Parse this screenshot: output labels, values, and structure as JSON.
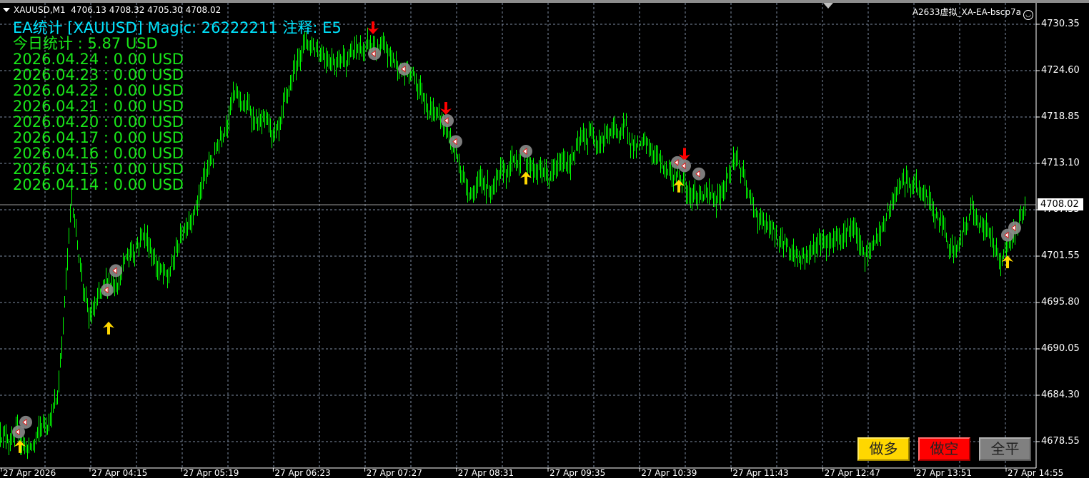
{
  "header": {
    "symbol": "XAUUSD,M1",
    "ohlc": "4706.13 4708.32 4705.30 4708.02",
    "account": "A2633虚拟_XA-EA-bscp7a",
    "account_icon": "smiley-icon"
  },
  "stats": {
    "title": "EA统计 [XAUUSD] Magic: 26222211 注释: E5",
    "lines": [
      "今日统计 : 5.87 USD",
      "2026.04.24 : 0.00 USD",
      "2026.04.23 : 0.00 USD",
      "2026.04.22 : 0.00 USD",
      "2026.04.21 : 0.00 USD",
      "2026.04.20 : 0.00 USD",
      "2026.04.17 : 0.00 USD",
      "2026.04.16 : 0.00 USD",
      "2026.04.15 : 0.00 USD",
      "2026.04.14 : 0.00 USD"
    ]
  },
  "buttons": {
    "buy": "做多",
    "sell": "做空",
    "close_all": "全平"
  },
  "colors": {
    "bars": "#00ff00",
    "buy": "#ffd700",
    "sell": "#ff0000",
    "close": "#808080",
    "title": "#00e5ff",
    "stats": "#19e619",
    "grid": "#7f8ea3"
  },
  "chart_data": {
    "type": "bar",
    "timeframe": "M1",
    "current_price": "4708.02",
    "price_ticks": [
      "4730.35",
      "4724.60",
      "4718.85",
      "4713.10",
      "4707.35",
      "4701.55",
      "4695.80",
      "4690.05",
      "4684.30",
      "4678.55"
    ],
    "time_ticks": [
      "27 Apr 2026",
      "27 Apr 04:15",
      "27 Apr 05:19",
      "27 Apr 06:23",
      "27 Apr 07:27",
      "27 Apr 08:31",
      "27 Apr 09:35",
      "27 Apr 10:39",
      "27 Apr 11:43",
      "27 Apr 12:47",
      "27 Apr 13:51",
      "27 Apr 14:55"
    ],
    "grid": true,
    "price_path": [
      {
        "t": "03:12",
        "p": 4680.2
      },
      {
        "t": "03:34",
        "p": 4677.6
      },
      {
        "t": "03:52",
        "p": 4683.8
      },
      {
        "t": "04:02",
        "p": 4708.6
      },
      {
        "t": "04:14",
        "p": 4693.5
      },
      {
        "t": "04:32",
        "p": 4698.8
      },
      {
        "t": "04:52",
        "p": 4705.0
      },
      {
        "t": "05:09",
        "p": 4698.0
      },
      {
        "t": "05:22",
        "p": 4706.0
      },
      {
        "t": "05:42",
        "p": 4714.0
      },
      {
        "t": "05:54",
        "p": 4721.8
      },
      {
        "t": "06:27",
        "p": 4715.6
      },
      {
        "t": "06:44",
        "p": 4728.5
      },
      {
        "t": "07:07",
        "p": 4726.7
      },
      {
        "t": "07:34",
        "p": 4727.2
      },
      {
        "t": "08:02",
        "p": 4723.6
      },
      {
        "t": "08:22",
        "p": 4718.3
      },
      {
        "t": "08:39",
        "p": 4710.4
      },
      {
        "t": "09:02",
        "p": 4710.4
      },
      {
        "t": "09:17",
        "p": 4714.3
      },
      {
        "t": "09:37",
        "p": 4711.2
      },
      {
        "t": "10:07",
        "p": 4717.0
      },
      {
        "t": "10:27",
        "p": 4717.0
      },
      {
        "t": "10:52",
        "p": 4713.4
      },
      {
        "t": "11:32",
        "p": 4708.1
      },
      {
        "t": "11:47",
        "p": 4714.3
      },
      {
        "t": "11:57",
        "p": 4707.7
      },
      {
        "t": "12:12",
        "p": 4704.1
      },
      {
        "t": "12:32",
        "p": 4701.5
      },
      {
        "t": "13:07",
        "p": 4705.9
      },
      {
        "t": "13:17",
        "p": 4700.6
      },
      {
        "t": "13:44",
        "p": 4710.4
      },
      {
        "t": "13:57",
        "p": 4709.5
      },
      {
        "t": "14:22",
        "p": 4702.4
      },
      {
        "t": "14:32",
        "p": 4707.7
      },
      {
        "t": "14:52",
        "p": 4701.9
      },
      {
        "t": "15:10",
        "p": 4708.0
      }
    ],
    "markers": [
      {
        "type": "buy-arrow",
        "t": "03:26",
        "p": 4677.9
      },
      {
        "type": "buy-arrow",
        "t": "04:28",
        "p": 4692.6
      },
      {
        "type": "buy-arrow",
        "t": "09:20",
        "p": 4711.2
      },
      {
        "type": "buy-arrow",
        "t": "11:07",
        "p": 4710.2
      },
      {
        "type": "buy-arrow",
        "t": "14:57",
        "p": 4700.8
      },
      {
        "type": "sell-arrow",
        "t": "07:33",
        "p": 4730.0
      },
      {
        "type": "sell-arrow",
        "t": "08:24",
        "p": 4720.0
      },
      {
        "type": "sell-arrow",
        "t": "11:11",
        "p": 4714.3
      },
      {
        "type": "deal",
        "t": "03:25",
        "p": 4679.8
      },
      {
        "type": "deal",
        "t": "03:30",
        "p": 4681.0
      },
      {
        "type": "deal",
        "t": "04:27",
        "p": 4697.4
      },
      {
        "type": "deal",
        "t": "04:33",
        "p": 4699.8
      },
      {
        "type": "deal",
        "t": "07:34",
        "p": 4726.7
      },
      {
        "type": "deal",
        "t": "07:55",
        "p": 4724.8
      },
      {
        "type": "deal",
        "t": "08:25",
        "p": 4718.4
      },
      {
        "type": "deal",
        "t": "08:31",
        "p": 4715.8
      },
      {
        "type": "deal",
        "t": "09:20",
        "p": 4714.6
      },
      {
        "type": "deal",
        "t": "11:06",
        "p": 4713.2
      },
      {
        "type": "deal",
        "t": "11:11",
        "p": 4712.8
      },
      {
        "type": "deal",
        "t": "11:21",
        "p": 4711.8
      },
      {
        "type": "deal",
        "t": "14:57",
        "p": 4704.2
      },
      {
        "type": "deal",
        "t": "15:02",
        "p": 4705.1
      }
    ]
  }
}
